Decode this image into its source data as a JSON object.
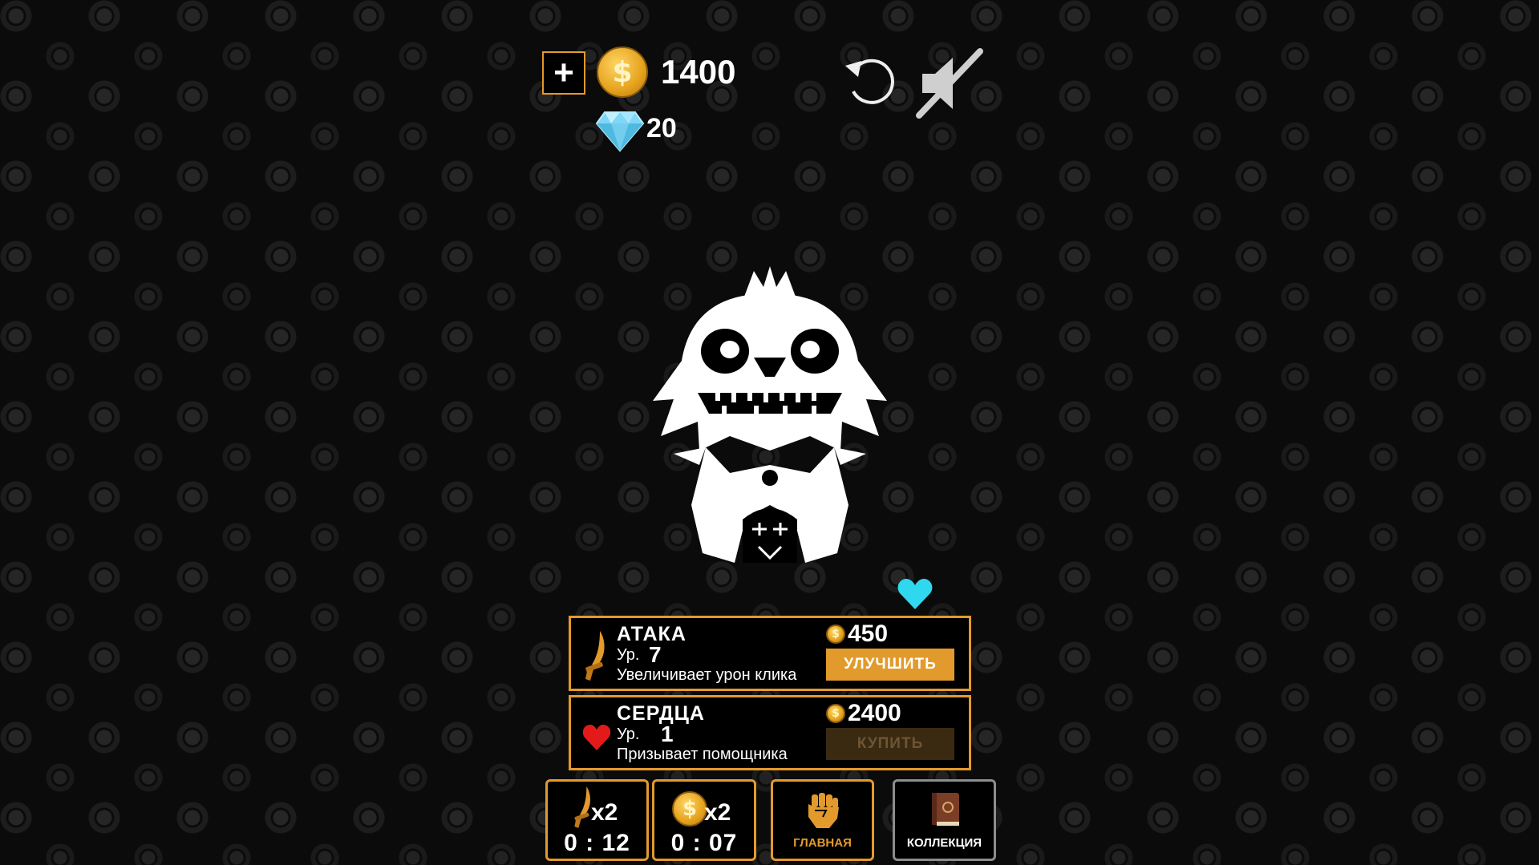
{
  "currency": {
    "plus_label": "+",
    "coin_symbol": "$",
    "gold": "1400",
    "gems": "20"
  },
  "controls": {
    "restart_icon": "restart-icon",
    "mute_icon": "sound-muted-icon"
  },
  "upgrades": [
    {
      "icon": "knife-icon",
      "title": "АТАКА",
      "level_label": "Ур.",
      "level": "7",
      "description": "Увеличивает урон клика",
      "price": "450",
      "button": "УЛУЧШИТЬ",
      "button_enabled": true
    },
    {
      "icon": "heart-icon",
      "title": "СЕРДЦА",
      "level_label": "Ур.",
      "level": "1",
      "description": "Призывает помощника",
      "price": "2400",
      "button": "КУПИТЬ",
      "button_enabled": false
    }
  ],
  "boosts": [
    {
      "icon": "knife-icon",
      "multiplier": "x2",
      "timer": "0 : 12"
    },
    {
      "icon": "coin-icon",
      "multiplier": "x2",
      "timer": "0 : 07"
    }
  ],
  "nav": {
    "home": {
      "icon": "fist-icon",
      "label": "ГЛАВНАЯ"
    },
    "collection": {
      "icon": "book-icon",
      "label": "КОЛЛЕКЦИЯ"
    }
  },
  "colors": {
    "accent": "#e39a2c",
    "background": "#0b0b0b",
    "soul": "#2fd8ee",
    "heart": "#e41a1a"
  }
}
